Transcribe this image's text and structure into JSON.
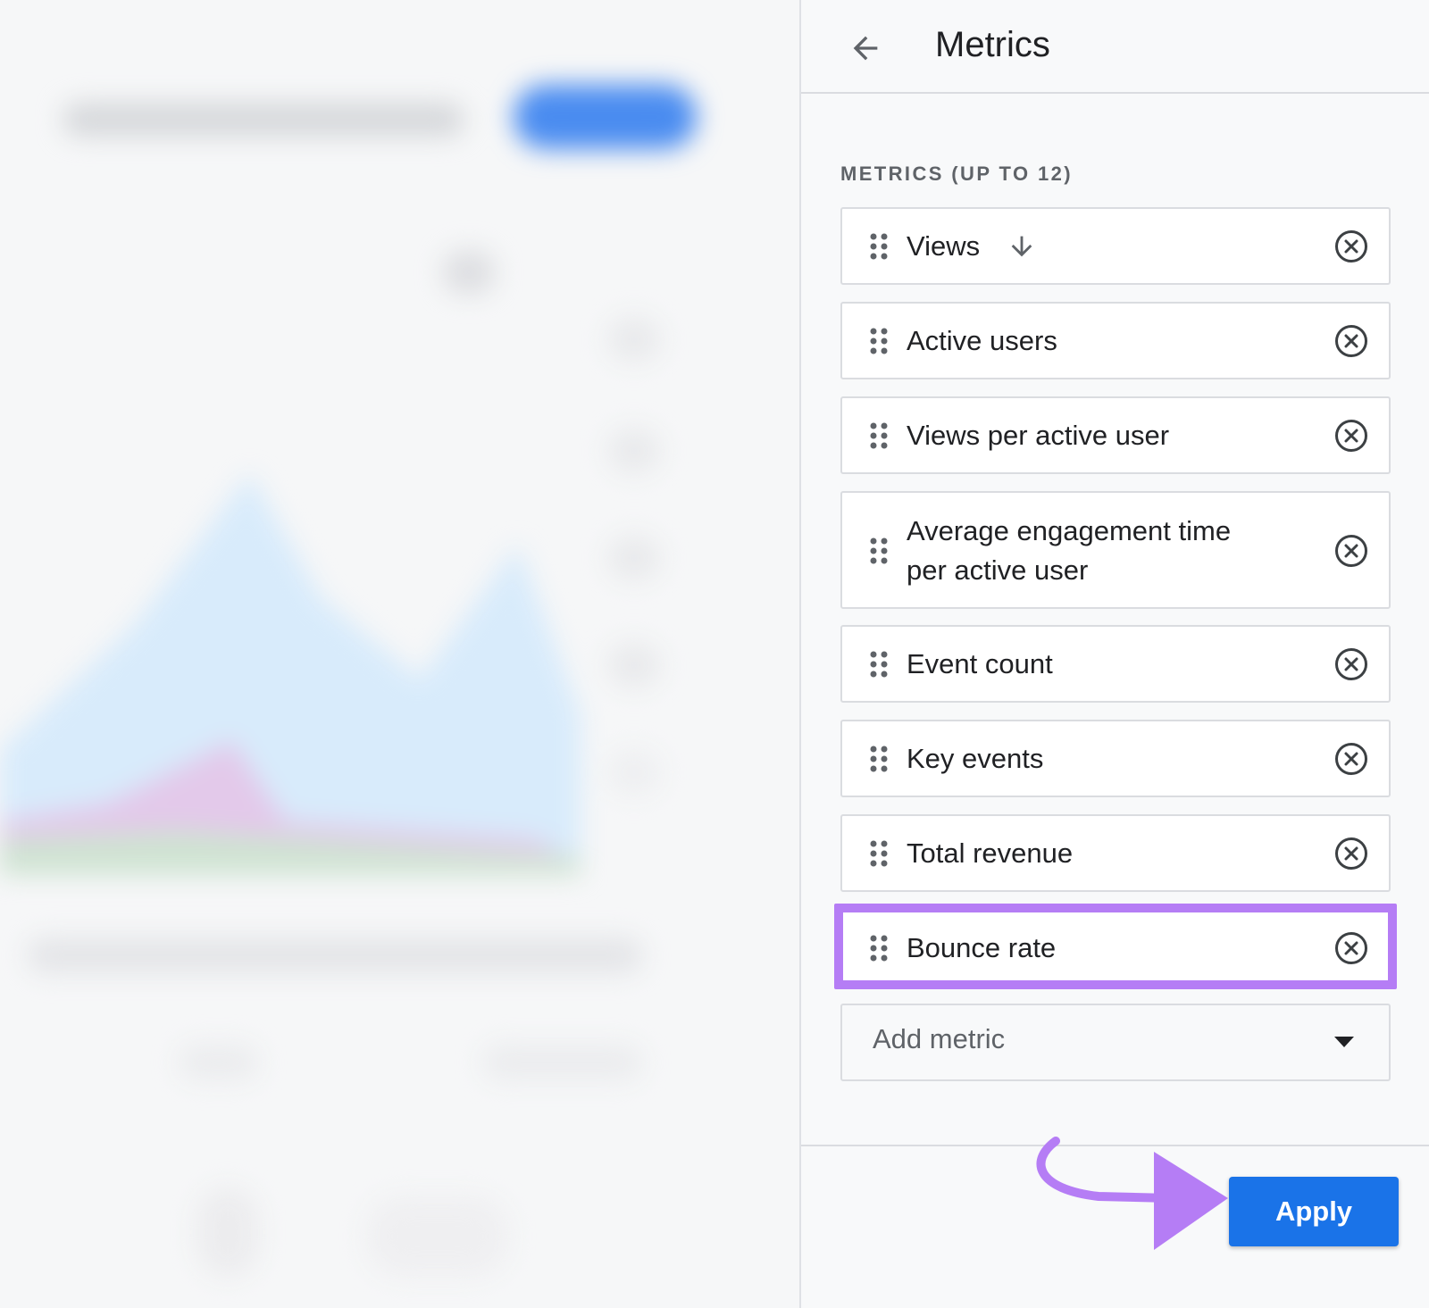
{
  "panel": {
    "title": "Metrics",
    "section_label": "METRICS (UP TO 12)"
  },
  "metrics": [
    {
      "label_line1": "Views",
      "label_line2": "",
      "sorted": "descending"
    },
    {
      "label_line1": "Active users",
      "label_line2": ""
    },
    {
      "label_line1": "Views per active user",
      "label_line2": ""
    },
    {
      "label_line1": "Average engagement time",
      "label_line2": "per active user"
    },
    {
      "label_line1": "Event count",
      "label_line2": ""
    },
    {
      "label_line1": "Key events",
      "label_line2": ""
    },
    {
      "label_line1": "Total revenue",
      "label_line2": ""
    },
    {
      "label_line1": "Bounce rate",
      "label_line2": "",
      "highlighted": true
    }
  ],
  "add_metric": {
    "placeholder": "Add metric"
  },
  "footer": {
    "apply_label": "Apply"
  },
  "icons": {
    "back": "arrow-back-icon",
    "drag": "drag-indicator-icon",
    "sort": "arrow-down-icon",
    "remove": "cancel-circle-icon",
    "dropdown": "caret-down-icon"
  },
  "colors": {
    "accent": "#1a73e8",
    "annotation": "#b57df5",
    "text": "#202124",
    "muted": "#5f6368",
    "border": "#dadce0"
  }
}
